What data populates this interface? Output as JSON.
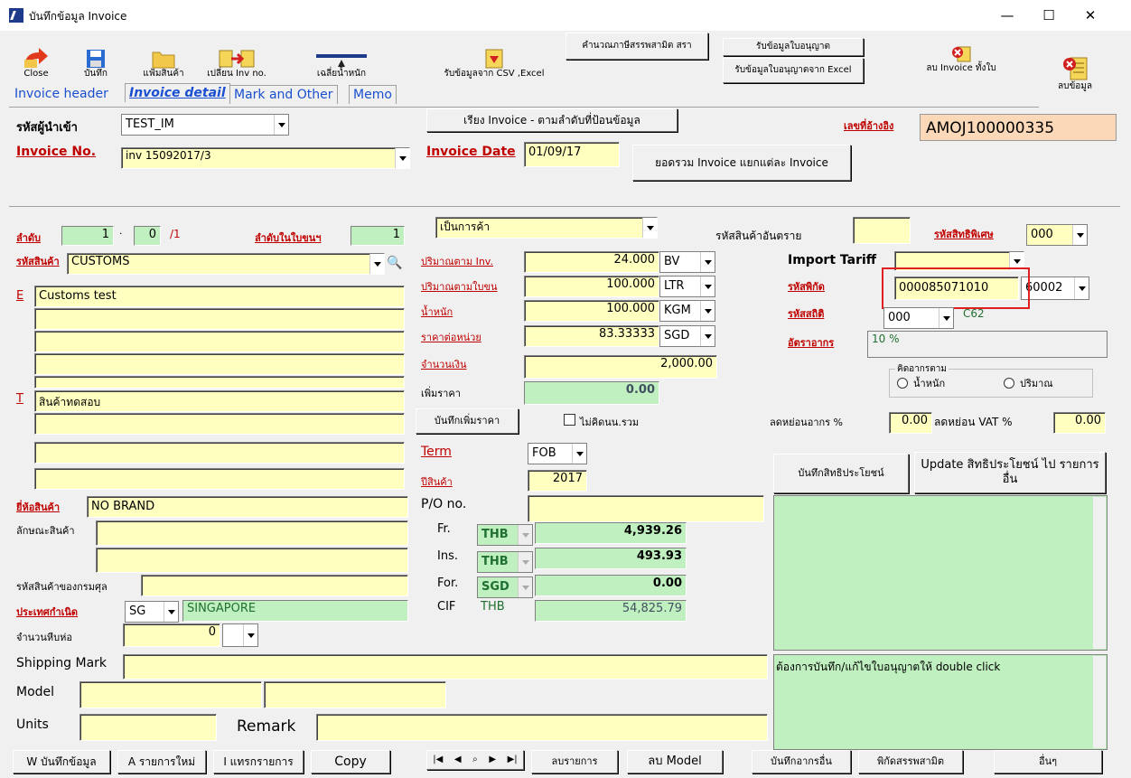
{
  "window": {
    "title": "บันทึกข้อมูล Invoice",
    "minimize": "—",
    "maximize": "☐",
    "close": "✕"
  },
  "toolbar": {
    "close": "Close",
    "save": "บันทึก",
    "product_file": "แฟ้มสินค้า",
    "change_inv": "เปลี่ยน Inv no.",
    "avg_weight": "เฉลี่ยน้ำหนัก",
    "import_csv": "รับข้อมูลจาก CSV ,Excel",
    "calc_excise": "คำนวณภาษีสรรพสามิต สรา",
    "receive_permit": "รับข้อมูลใบอนุญาต",
    "receive_permit_excel": "รับข้อมูลใบอนุญาตจาก Excel",
    "delete_invoice": "ลบ Invoice ทั้งใบ",
    "delete_data": "ลบข้อมูล"
  },
  "tabs": [
    "Invoice header",
    "Invoice detail",
    "Mark and Other",
    "Memo"
  ],
  "header": {
    "importer_label": "รหัสผู้นำเข้า",
    "importer_value": "TEST_IM",
    "sort_btn": "เรียง Invoice - ตามลำดับที่ป้อนข้อมูล",
    "ref_label": "เลขที่อ้างอิง",
    "ref_value": "AMOJ100000335",
    "invoice_no_label": "Invoice No.",
    "invoice_no_value": "inv 15092017/3",
    "invoice_date_label": "Invoice Date",
    "invoice_date_value": "01/09/17",
    "total_btn": "ยอดรวม Invoice แยกแต่ละ Invoice"
  },
  "left": {
    "seq_label": "ลำดับ",
    "seq_value": "1",
    "seq_sub": "0",
    "seq_slash": "/1",
    "cargo_seq_label": "ลำดับในใบขนฯ",
    "cargo_seq_value": "1",
    "product_code_label": "รหัสสินค้า",
    "product_code_value": "CUSTOMS",
    "e_label": "E",
    "e_lines": [
      "Customs test",
      "",
      "",
      "",
      ""
    ],
    "t_label": "T",
    "t_lines": [
      "สินค้าทดสอบ",
      "",
      "",
      ""
    ],
    "brand_label": "ยี่ห้อสินค้า",
    "brand_value": "NO BRAND",
    "char_label": "ลักษณะสินค้า",
    "customs_code_label": "รหัสสินค้าของกรมศุล",
    "origin_label": "ประเทศกำเนิด",
    "origin_code": "SG",
    "origin_name": "SINGAPORE",
    "pkg_label": "จำนวนหีบห่อ",
    "pkg_value": "0",
    "shipping_label": "Shipping Mark",
    "model_label": "Model",
    "units_label": "Units",
    "remark_label": "Remark"
  },
  "mid": {
    "type_value": "เป็นการค้า",
    "qty_inv_label": "ปริมาณตาม Inv.",
    "qty_inv_value": "24.000",
    "qty_inv_unit": "BV",
    "qty_doc_label": "ปริมาณตามใบขน",
    "qty_doc_value": "100.000",
    "qty_doc_unit": "LTR",
    "weight_label": "น้ำหนัก",
    "weight_value": "100.000",
    "weight_unit": "KGM",
    "price_label": "ราคาต่อหน่วย",
    "price_value": "83.33333",
    "price_unit": "SGD",
    "amount_label": "จำนวนเงิน",
    "amount_value": "2,000.00",
    "add_price_label": "เพิ่มราคา",
    "add_price_value": "0.00",
    "save_add_btn": "บันทึกเพิ่มราคา",
    "no_calc_label": "ไม่คิดนน.รวม",
    "term_label": "Term",
    "term_value": "FOB",
    "year_label": "ปีสินค้า",
    "year_value": "2017",
    "po_label": "P/O no.",
    "fr_label": "Fr.",
    "fr_cur": "THB",
    "fr_value": "4,939.26",
    "ins_label": "Ins.",
    "ins_cur": "THB",
    "ins_value": "493.93",
    "for_label": "For.",
    "for_cur": "SGD",
    "for_value": "0.00",
    "cif_label": "CIF",
    "cif_cur": "THB",
    "cif_value": "54,825.79"
  },
  "right": {
    "hazard_label": "รหัสสินค้าอันตราย",
    "priv_label": "รหัสสิทธิพิเศษ",
    "priv_value": "000",
    "tariff_label": "Import Tariff",
    "hs_label": "รหัสพิกัด",
    "hs_value": "000085071010",
    "hs_suffix": "60002",
    "stat_label": "รหัสสถิติ",
    "stat_value": "000",
    "stat_code": "C62",
    "rate_label": "อัตราอากร",
    "rate_value": "10 %",
    "duty_group": "คิดอากรตาม",
    "duty_weight": "น้ำหนัก",
    "duty_qty": "ปริมาณ",
    "duty_reduce_label": "ลดหย่อนอากร %",
    "duty_reduce_value": "0.00",
    "vat_reduce_label": "ลดหย่อน VAT %",
    "vat_reduce_value": "0.00",
    "save_priv_btn": "บันทึกสิทธิประโยชน์",
    "update_priv_btn": "Update สิทธิประโยชน์ ไป รายการอื่น",
    "permit_hint": "ต้องการบันทึก/แก้ไขใบอนุญาตให้ double click"
  },
  "bottom": {
    "save": "W บันทึกข้อมูล",
    "new": "A รายการใหม่",
    "insert": "I แทรกรายการ",
    "copy": "Copy",
    "delete_item": "ลบรายการ",
    "delete_model": "ลบ Model",
    "save_other": "บันทึกอากรอื่น",
    "excise": "พิกัดสรรพสามิต",
    "other": "อื่นๆ"
  },
  "colors": {
    "field": "#ffffc0",
    "green": "#c0f0c0",
    "label_red": "#c00000",
    "highlight": "#e02020"
  }
}
